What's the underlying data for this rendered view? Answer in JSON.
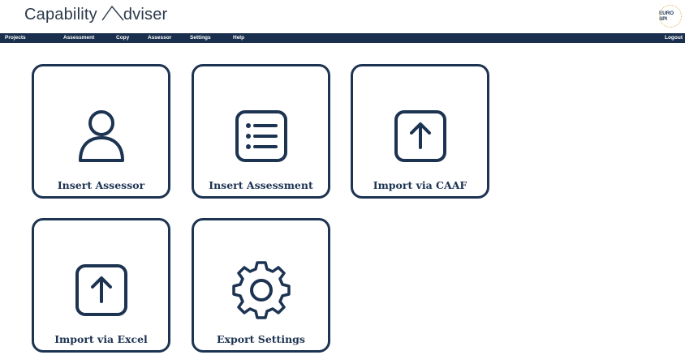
{
  "app": {
    "brand_left": "Capability",
    "brand_right": "dviser",
    "logo_text": "EURO SPI"
  },
  "nav": {
    "items": [
      "Projects",
      "Assessment",
      "Copy",
      "Assessor",
      "Settings",
      "Help"
    ],
    "logout": "Logout"
  },
  "tiles": [
    {
      "label": "Insert Assessor",
      "icon": "user-icon"
    },
    {
      "label": "Insert Assessment",
      "icon": "list-icon"
    },
    {
      "label": "Import via CAAF",
      "icon": "upload-icon"
    },
    {
      "label": "Import via Excel",
      "icon": "upload-icon"
    },
    {
      "label": "Export Settings",
      "icon": "gear-icon"
    }
  ],
  "colors": {
    "navy": "#1d3352",
    "navbar": "#1a2f4d"
  }
}
